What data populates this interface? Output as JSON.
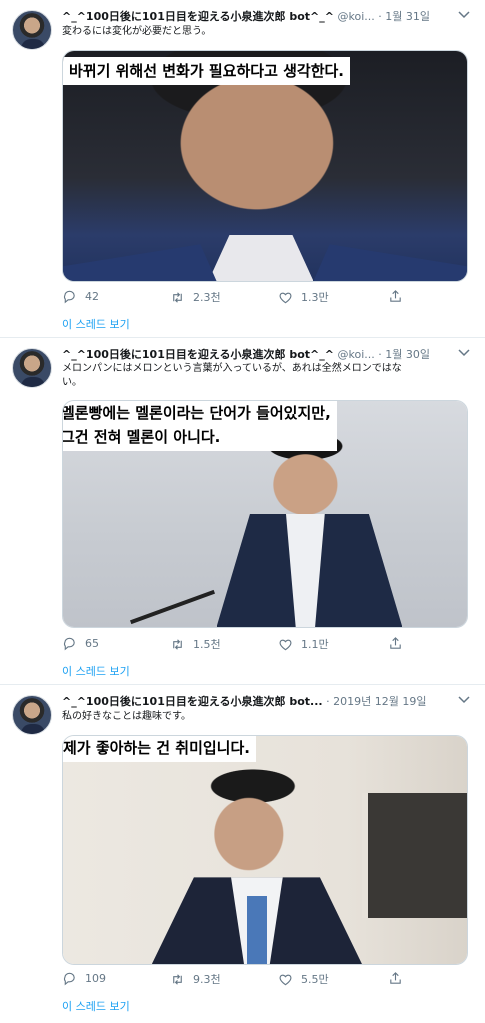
{
  "tweets": [
    {
      "name": "^_^100日後に101日目を迎える小泉進次郎 bot^_^",
      "handle": "@koi...",
      "date": "1월 31일",
      "text": "変わるには変化が必要だと思う。",
      "caption": [
        "바뀌기 위해선 변화가 필요하다고 생각한다."
      ],
      "replies": "42",
      "retweets": "2.3천",
      "likes": "1.3만",
      "thread": "이 스레드 보기"
    },
    {
      "name": "^_^100日後に101日目を迎える小泉進次郎 bot^_^",
      "handle": "@koi...",
      "date": "1월 30일",
      "text": "メロンパンにはメロンという言葉が入っているが、あれは全然メロンではない。",
      "text_lines": [
        "メロンパンにはメロンという言葉が入っているが、あれは全然メロンではな",
        "い。"
      ],
      "caption": [
        "멜론빵에는 멜론이라는 단어가 들어있지만,",
        "그건 전혀 멜론이 아니다."
      ],
      "replies": "65",
      "retweets": "1.5천",
      "likes": "1.1만",
      "thread": "이 스레드 보기"
    },
    {
      "name": "^_^100日後に101日目を迎える小泉進次郎 bot...",
      "handle": "",
      "date": "2019년 12월 19일",
      "text": "私の好きなことは趣味です。",
      "caption": [
        "제가 좋아하는 건 취미입니다."
      ],
      "replies": "109",
      "retweets": "9.3천",
      "likes": "5.5만",
      "thread": "이 스레드 보기"
    }
  ],
  "dot": "·",
  "colors": {
    "link": "#1da1f2",
    "muted": "#657786",
    "border": "#e6ecf0"
  },
  "icons": [
    "reply-icon",
    "retweet-icon",
    "like-icon",
    "share-icon",
    "chevron-down-icon"
  ]
}
